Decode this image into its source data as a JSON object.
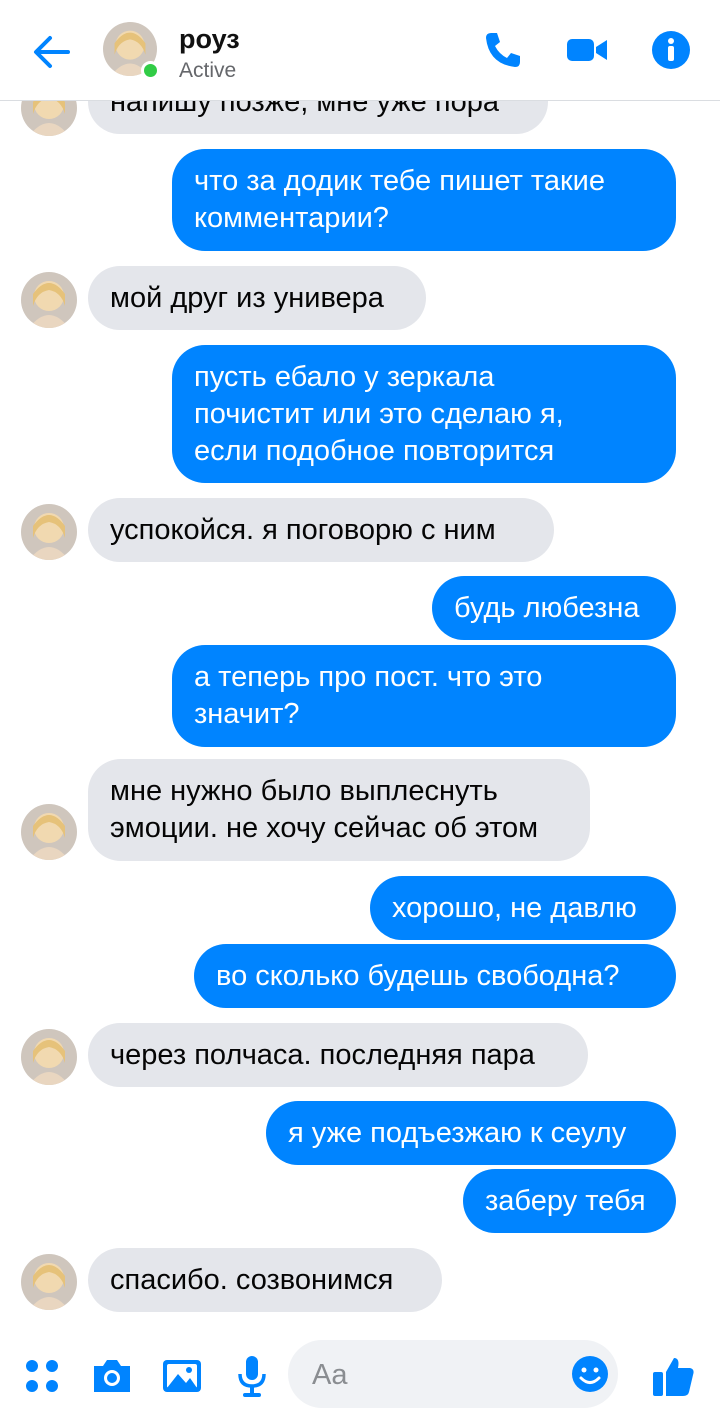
{
  "header": {
    "contact_name": "роуз",
    "status": "Active"
  },
  "colors": {
    "accent": "#0084ff",
    "incoming_bubble": "#e4e6eb",
    "online": "#31cc46"
  },
  "icons": {
    "back": "back-arrow-icon",
    "call": "phone-icon",
    "video": "video-camera-icon",
    "info": "info-icon",
    "menu": "four-dots-icon",
    "camera": "camera-icon",
    "gallery": "image-icon",
    "mic": "microphone-icon",
    "emoji": "smiley-icon",
    "like": "thumbs-up-icon"
  },
  "messages": [
    {
      "from": "in",
      "text": "напишу позже, мне уже пора"
    },
    {
      "from": "out",
      "text": "что за додик тебе пишет такие\nкомментарии?"
    },
    {
      "from": "in",
      "text": "мой друг из универа"
    },
    {
      "from": "out",
      "text": "пусть ебало у зеркала\nпочистит или это сделаю я,\nесли подобное повторится"
    },
    {
      "from": "in",
      "text": "успокойся. я поговорю с ним"
    },
    {
      "from": "out",
      "text": "будь любезна"
    },
    {
      "from": "out",
      "text": "а теперь про пост. что это\nзначит?"
    },
    {
      "from": "in",
      "text": "мне нужно было выплеснуть\nэмоции. не хочу сейчас об этом"
    },
    {
      "from": "out",
      "text": "хорошо, не давлю"
    },
    {
      "from": "out",
      "text": "во сколько будешь свободна?"
    },
    {
      "from": "in",
      "text": "через полчаса. последняя пара"
    },
    {
      "from": "out",
      "text": "я уже подъезжаю к сеулу"
    },
    {
      "from": "out",
      "text": "заберу тебя"
    },
    {
      "from": "in",
      "text": "спасибо. созвонимся"
    }
  ],
  "composer": {
    "placeholder": "Aa"
  }
}
